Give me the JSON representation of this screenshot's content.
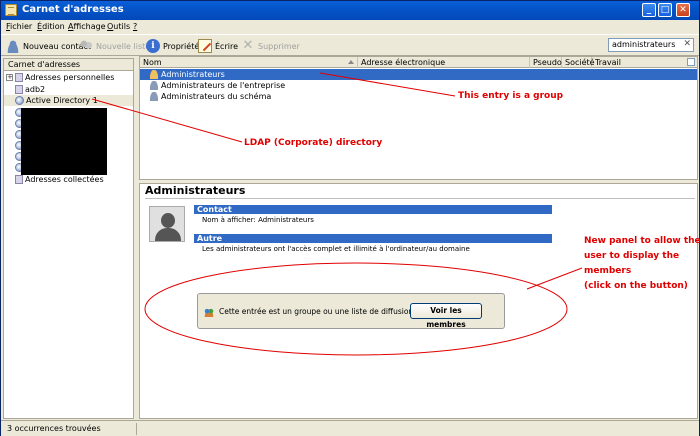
{
  "window": {
    "title": "Carnet d'adresses",
    "minimize": "_",
    "maximize": "□",
    "close": "✕"
  },
  "menu": {
    "items": [
      {
        "key": "F",
        "rest": "ichier"
      },
      {
        "key": "É",
        "rest": "dition"
      },
      {
        "key": "A",
        "rest": "ffichage"
      },
      {
        "key": "O",
        "rest": "utils"
      },
      {
        "key": "?",
        "rest": ""
      }
    ]
  },
  "toolbar": {
    "new_contact": "Nouveau contact",
    "new_list": "Nouvelle liste",
    "properties": "Propriétés",
    "write": "Écrire",
    "delete": "Supprimer",
    "icons": {
      "new_contact": "new-contact-icon",
      "new_list": "new-list-icon",
      "properties": "properties-icon",
      "write": "write-icon",
      "delete": "delete-icon"
    }
  },
  "search": {
    "value": "administrateurs",
    "clear": "✕"
  },
  "sidebar": {
    "header": "Carnet d'adresses",
    "items": [
      {
        "label": "Adresses personnelles",
        "icon": "book-icon",
        "expander": "+"
      },
      {
        "label": "adb2",
        "icon": "book-icon"
      },
      {
        "label": "Active Directory 1",
        "icon": "ldap-icon"
      },
      {
        "label": "",
        "icon": "ldap-icon"
      },
      {
        "label": "",
        "icon": "ldap-icon"
      },
      {
        "label": "",
        "icon": "ldap-icon"
      },
      {
        "label": "",
        "icon": "ldap-icon"
      },
      {
        "label": "",
        "icon": "ldap-icon"
      },
      {
        "label": "",
        "icon": "ldap-icon"
      },
      {
        "label": "Adresses collectées",
        "icon": "book-icon"
      }
    ]
  },
  "results": {
    "columns": [
      "Nom",
      "Adresse électronique",
      "Pseudo",
      "Société",
      "Travail"
    ],
    "rows": [
      {
        "name": "Administrateurs",
        "selected": true
      },
      {
        "name": "Administrateurs de l'entreprise",
        "selected": false
      },
      {
        "name": "Administrateurs du schéma",
        "selected": false
      }
    ]
  },
  "details": {
    "title": "Administrateurs",
    "contact_header": "Contact",
    "display_name": "Nom à afficher: Administrateurs",
    "other_header": "Autre",
    "description": "Les administrateurs ont l'accès complet et illimité à l'ordinateur/au domaine",
    "group_text": "Cette entrée est un groupe ou une liste de diffusion.",
    "view_members_button": "Voir les membres"
  },
  "status": {
    "text": "3 occurrences trouvées"
  },
  "annotations": {
    "group_entry": "This entry is a group",
    "ldap": "LDAP (Corporate) directory",
    "new_panel_line1": "New panel to allow the",
    "new_panel_line2": "user to display the",
    "new_panel_line3": "members",
    "new_panel_line4": "(click on the button)",
    "color": "#e00000"
  }
}
